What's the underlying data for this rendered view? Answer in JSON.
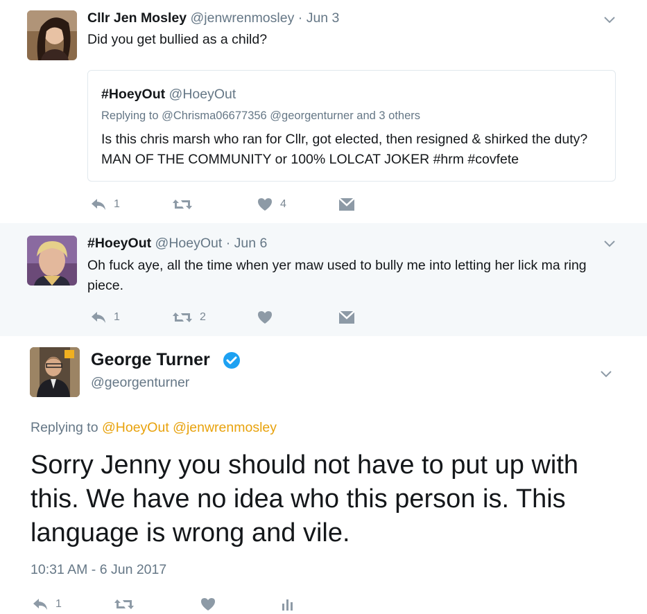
{
  "tweet1": {
    "name": "Cllr Jen Mosley",
    "handle": "@jenwrenmosley",
    "separator": "·",
    "date": "Jun 3",
    "text": "Did you get bullied as a child?",
    "quoted": {
      "name": "#HoeyOut",
      "handle": "@HoeyOut",
      "replying": "Replying to @Chrisma06677356 @georgenturner and 3 others",
      "text": "Is this chris marsh who ran for Cllr, got elected, then resigned & shirked the duty? MAN OF THE COMMUNITY or 100% LOLCAT JOKER #hrm #covfete"
    },
    "actions": {
      "reply_count": "1",
      "retweet_count": "",
      "like_count": "4"
    }
  },
  "tweet2": {
    "name": "#HoeyOut",
    "handle": "@HoeyOut",
    "separator": "·",
    "date": "Jun 6",
    "text": "Oh fuck aye, all the time when yer maw used to bully me into letting her lick ma ring piece.",
    "actions": {
      "reply_count": "1",
      "retweet_count": "2",
      "like_count": ""
    }
  },
  "focused": {
    "name": "George Turner",
    "handle": "@georgenturner",
    "replying_prefix": "Replying to",
    "mentions": "@HoeyOut @jenwrenmosley",
    "text": "Sorry Jenny you should not have to put up with this. We have no idea who this person is. This language is wrong and vile.",
    "timestamp": "10:31 AM - 6 Jun 2017",
    "actions": {
      "reply_count": "1"
    }
  },
  "colors": {
    "thread_line": "#f5c87a",
    "mention": "#e8a20c",
    "verified": "#1da1f2",
    "muted": "#657786",
    "icon": "#8d9aa6",
    "highlight_bg": "#f5f8fa"
  },
  "icons": [
    "reply-icon",
    "retweet-icon",
    "heart-icon",
    "dm-icon",
    "analytics-icon",
    "verified-icon",
    "caret-down-icon"
  ]
}
